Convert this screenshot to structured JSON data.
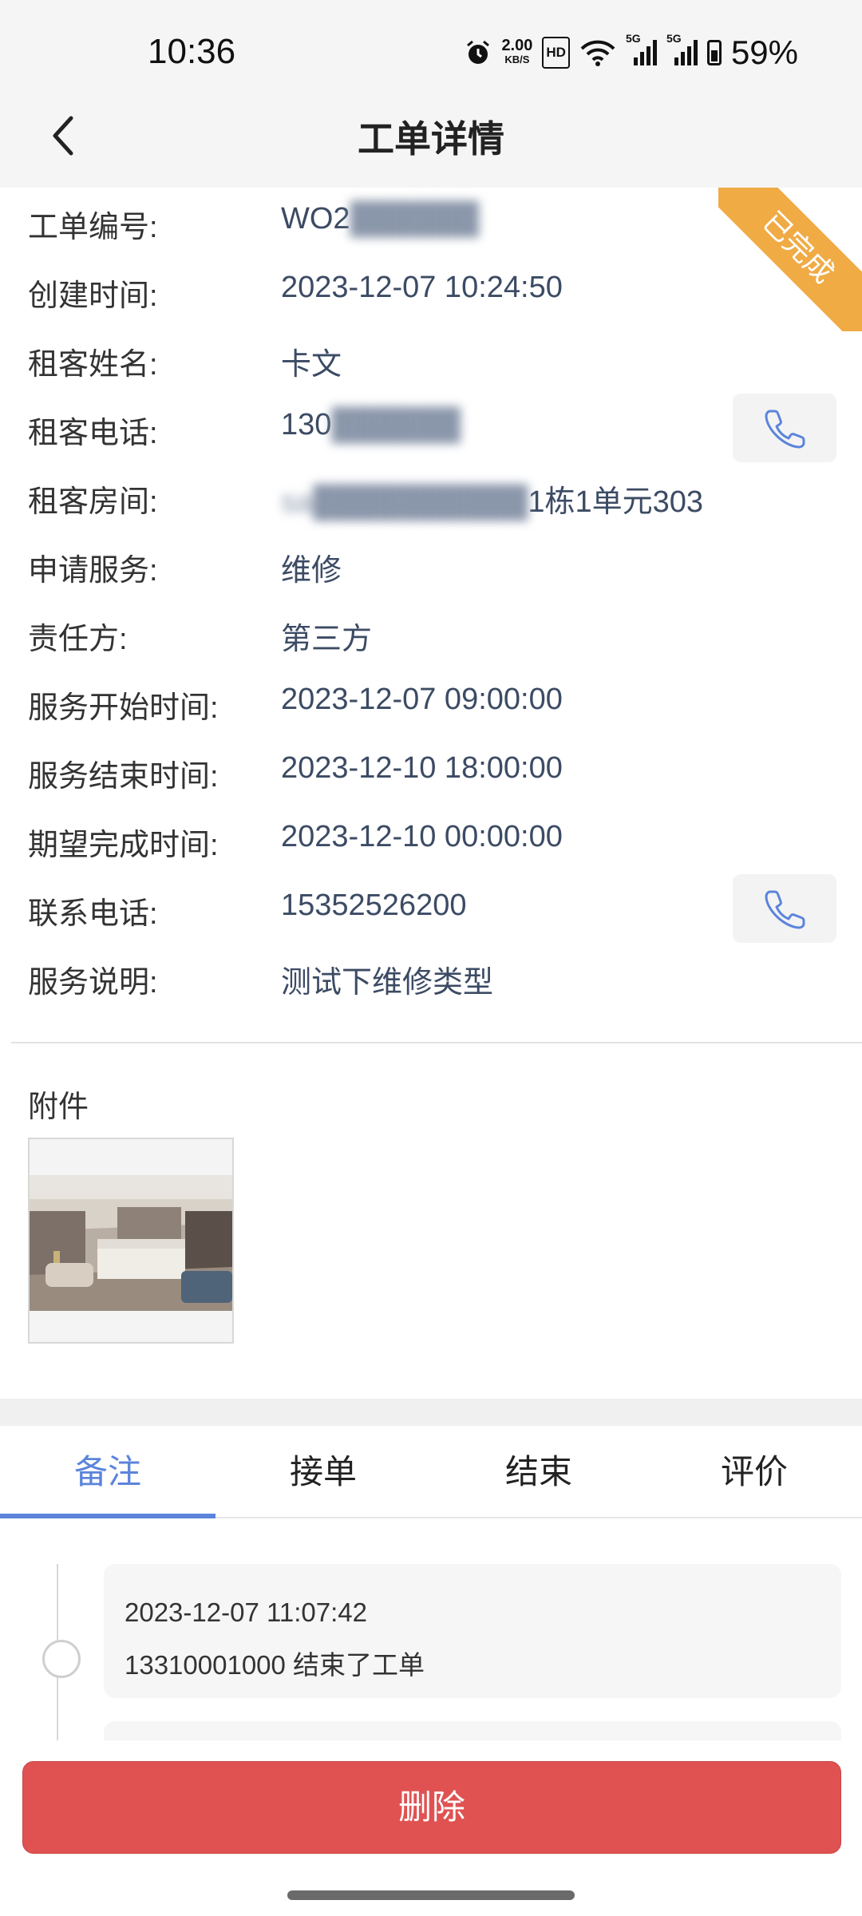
{
  "status_bar": {
    "time": "10:36",
    "net_speed_value": "2.00",
    "net_speed_unit": "KB/S",
    "hd_label": "HD",
    "sim1": "5G",
    "sim2": "5G",
    "battery": "59%"
  },
  "nav": {
    "title": "工单详情"
  },
  "ribbon": {
    "status": "已完成",
    "color": "#f0ab45"
  },
  "fields": [
    {
      "label": "工单编号:",
      "value": "WO2"
    },
    {
      "label": "创建时间:",
      "value": "2023-12-07 10:24:50"
    },
    {
      "label": "租客姓名:",
      "value": "卡文"
    },
    {
      "label": "租客电话:",
      "value": "130"
    },
    {
      "label": "租客房间:",
      "value_prefix": "sa",
      "value_suffix": "1栋1单元303"
    },
    {
      "label": "申请服务:",
      "value": "维修"
    },
    {
      "label": "责任方:",
      "value": "第三方"
    },
    {
      "label": "服务开始时间:",
      "value": "2023-12-07 09:00:00"
    },
    {
      "label": "服务结束时间:",
      "value": "2023-12-10 18:00:00"
    },
    {
      "label": "期望完成时间:",
      "value": "2023-12-10 00:00:00"
    },
    {
      "label": "联系电话:",
      "value": "15352526200"
    },
    {
      "label": "服务说明:",
      "value": "测试下维修类型"
    }
  ],
  "attachments": {
    "label": "附件"
  },
  "tabs": [
    {
      "label": "备注",
      "active": true
    },
    {
      "label": "接单",
      "active": false
    },
    {
      "label": "结束",
      "active": false
    },
    {
      "label": "评价",
      "active": false
    }
  ],
  "timeline": [
    {
      "time": "2023-12-07 11:07:42",
      "text": "13310001000 结束了工单"
    }
  ],
  "actions": {
    "delete_label": "删除",
    "delete_color": "#e05252"
  },
  "colors": {
    "accent": "#5b84db",
    "value_text": "#3c4b64"
  }
}
